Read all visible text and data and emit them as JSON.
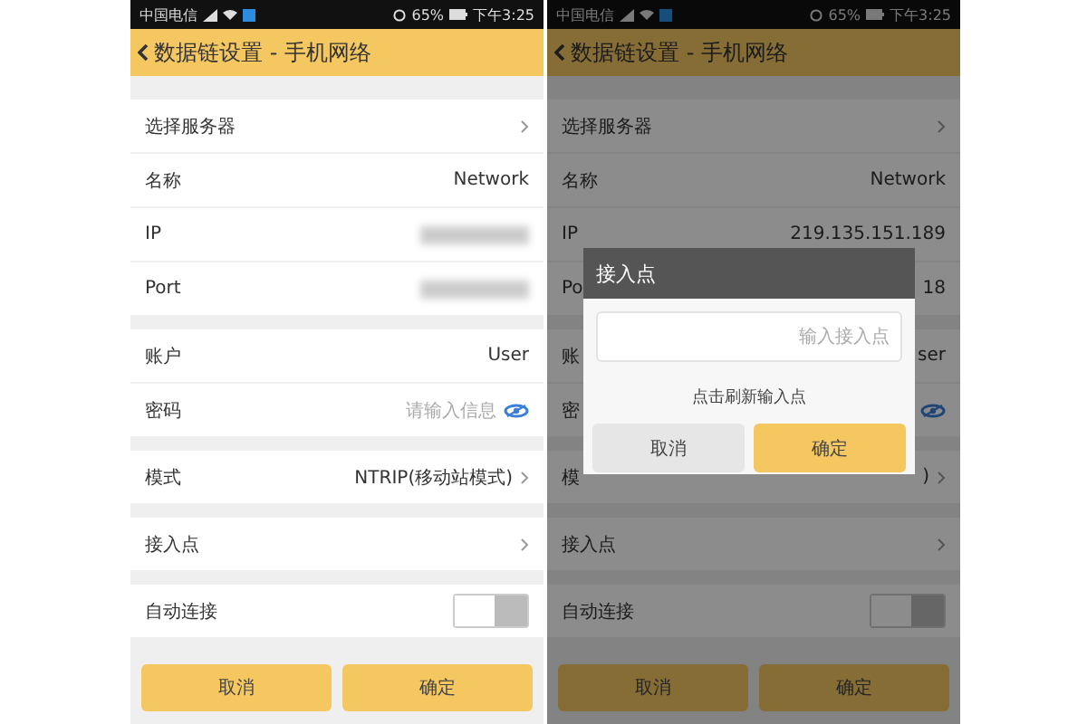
{
  "screens": [
    {
      "status_bar": {
        "carrier": "中国电信",
        "battery": "65%",
        "time": "下午3:25"
      },
      "header": {
        "title": "数据链设置 - 手机网络"
      },
      "groups": [
        [
          {
            "kind": "link",
            "label": "选择服务器"
          },
          {
            "kind": "value",
            "label": "名称",
            "value": "Network"
          },
          {
            "kind": "blurred",
            "label": "IP"
          },
          {
            "kind": "blurred",
            "label": "Port"
          }
        ],
        [
          {
            "kind": "value",
            "label": "账户",
            "value": "User"
          },
          {
            "kind": "password",
            "label": "密码",
            "placeholder": "请输入信息"
          }
        ],
        [
          {
            "kind": "link",
            "label": "模式",
            "value": "NTRIP(移动站模式)"
          }
        ],
        [
          {
            "kind": "link",
            "label": "接入点"
          }
        ],
        [
          {
            "kind": "toggle",
            "label": "自动连接",
            "on": false
          }
        ]
      ],
      "buttons": [
        "取消",
        "确定"
      ]
    },
    {
      "status_bar": {
        "carrier": "中国电信",
        "battery": "65%",
        "time": "下午3:25"
      },
      "header": {
        "title": "数据链设置 - 手机网络"
      },
      "groups": [
        [
          {
            "kind": "link",
            "label": "选择服务器"
          },
          {
            "kind": "value",
            "label": "名称",
            "value": "Network"
          },
          {
            "kind": "value",
            "label": "IP",
            "value": "219.135.151.189"
          },
          {
            "kind": "value",
            "label": "Po",
            "value": "18"
          }
        ],
        [
          {
            "kind": "value",
            "label": "账",
            "value": "ser"
          },
          {
            "kind": "password",
            "label": "密"
          }
        ],
        [
          {
            "kind": "link",
            "label": "模",
            "value": ")"
          }
        ],
        [
          {
            "kind": "link",
            "label": "接入点"
          }
        ],
        [
          {
            "kind": "toggle",
            "label": "自动连接",
            "on": false
          }
        ]
      ],
      "buttons": [
        "取消",
        "确定"
      ],
      "dialog": {
        "title": "接入点",
        "placeholder": "输入接入点",
        "hint": "点击刷新输入点",
        "buttons": [
          "取消",
          "确定"
        ]
      }
    }
  ]
}
